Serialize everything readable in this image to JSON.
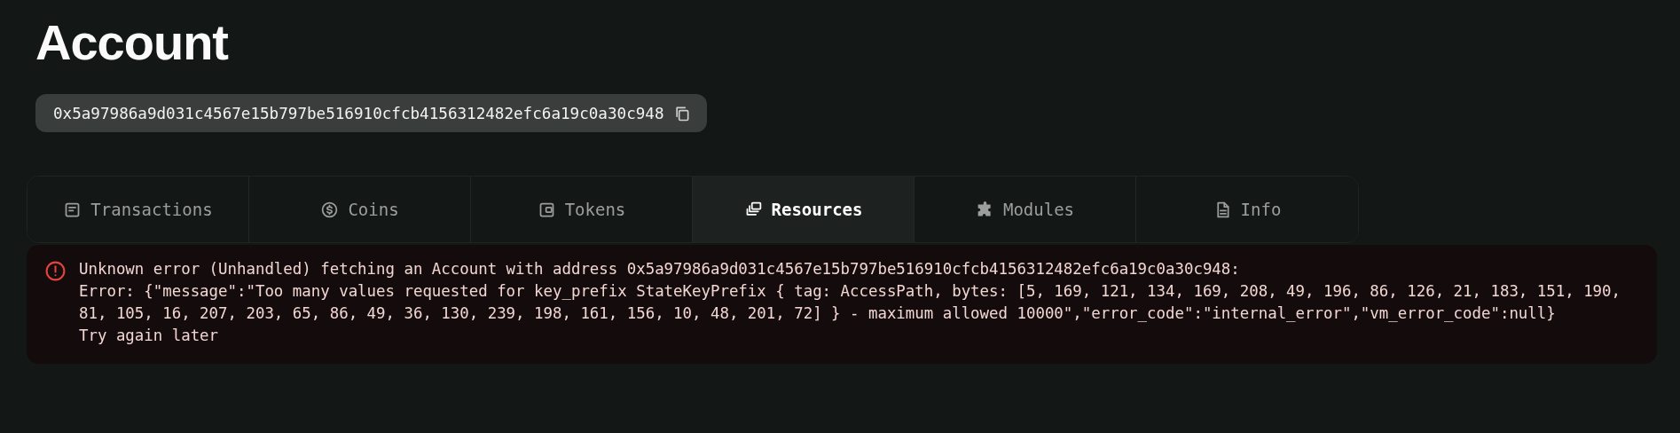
{
  "page_title": "Account",
  "address": {
    "text": "0x5a97986a9d031c4567e15b797be516910cfcb4156312482efc6a19c0a30c948"
  },
  "tabs": [
    {
      "label": "Transactions",
      "kind": "list",
      "selected": false
    },
    {
      "label": "Coins",
      "kind": "coin",
      "selected": false
    },
    {
      "label": "Tokens",
      "kind": "wallet",
      "selected": false
    },
    {
      "label": "Resources",
      "kind": "stack",
      "selected": true
    },
    {
      "label": "Modules",
      "kind": "puzzle",
      "selected": false
    },
    {
      "label": "Info",
      "kind": "doc",
      "selected": false
    }
  ],
  "error": {
    "lines": [
      "Unknown error (Unhandled) fetching an Account with address 0x5a97986a9d031c4567e15b797be516910cfcb4156312482efc6a19c0a30c948:",
      "Error: {\"message\":\"Too many values requested for key_prefix StateKeyPrefix { tag: AccessPath, bytes: [5, 169, 121, 134, 169, 208, 49, 196, 86, 126, 21, 183, 151, 190, 81, 105, 16, 207, 203, 65, 86, 49, 36, 130, 239, 198, 161, 156, 10, 48, 201, 72] } - maximum allowed 10000\",\"error_code\":\"internal_error\",\"vm_error_code\":null}",
      "Try again later"
    ]
  }
}
